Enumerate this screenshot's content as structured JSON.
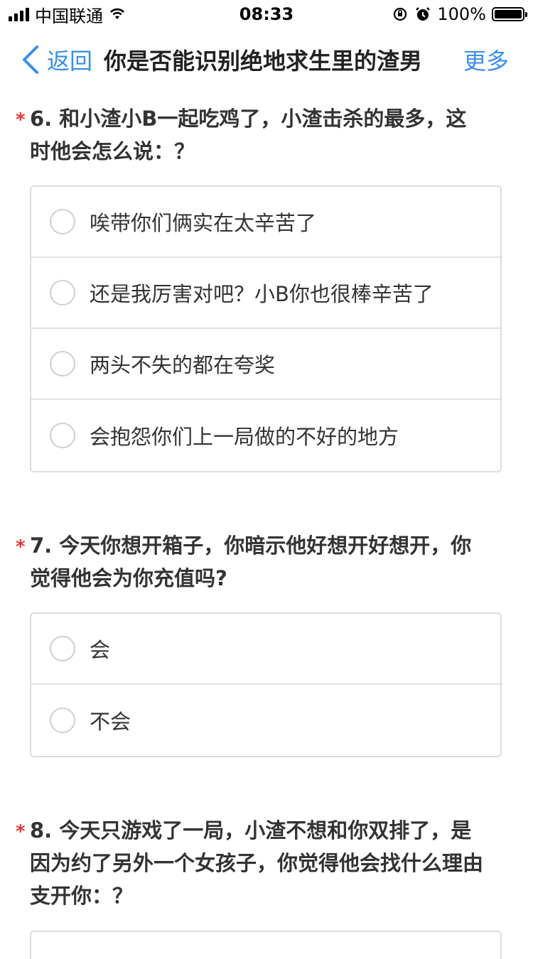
{
  "status_bar": {
    "carrier": "中国联通",
    "time": "08:33",
    "battery": "100%",
    "battery_level": 1.0
  },
  "nav": {
    "back_label": "返回",
    "title": "你是否能识别绝地求生里的渣男",
    "more_label": "更多"
  },
  "questions": [
    {
      "required_mark": "*",
      "title": "6. 和小渣小B一起吃鸡了，小渣击杀的最多，这时他会怎么说：？",
      "options": [
        "唉带你们俩实在太辛苦了",
        "还是我厉害对吧？小B你也很棒辛苦了",
        "两头不失的都在夸奖",
        "会抱怨你们上一局做的不好的地方"
      ]
    },
    {
      "required_mark": "*",
      "title": "7. 今天你想开箱子，你暗示他好想开好想开，你觉得他会为你充值吗?",
      "options": [
        "会",
        "不会"
      ]
    },
    {
      "required_mark": "*",
      "title": "8. 今天只游戏了一局，小渣不想和你双排了，是因为约了另外一个女孩子，你觉得他会找什么理由支开你：？",
      "options": []
    }
  ],
  "icons": {
    "accent_color": "#3a8ee6",
    "required_color": "#e53935"
  }
}
